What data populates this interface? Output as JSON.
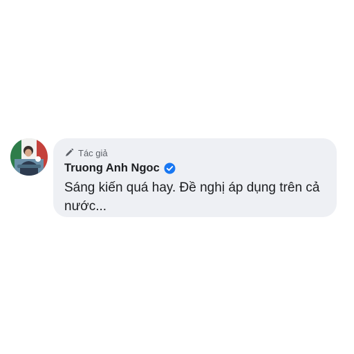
{
  "comment": {
    "author_badge": "Tác giả",
    "author_name": "Truong Anh Ngoc",
    "text": "Sáng kiến quá hay. Đề nghị áp dụng trên cả nước...",
    "avatar_icon": "user-avatar",
    "badge_icon": "pen-icon",
    "verified_icon": "verified-badge-icon"
  },
  "colors": {
    "bubble_bg": "#eef0f4",
    "verified_blue": "#1877f2",
    "text": "#1c1e21",
    "secondary_text": "#5b5f66"
  }
}
